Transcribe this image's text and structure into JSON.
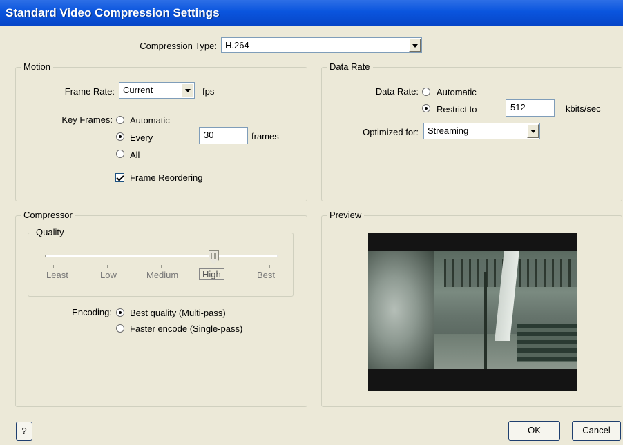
{
  "window": {
    "title": "Standard Video Compression Settings"
  },
  "compression_type": {
    "label": "Compression Type:",
    "value": "H.264"
  },
  "motion": {
    "legend": "Motion",
    "frame_rate_label": "Frame Rate:",
    "frame_rate_value": "Current",
    "fps_unit": "fps",
    "key_frames_label": "Key Frames:",
    "key_frames_options": [
      "Automatic",
      "Every",
      "All"
    ],
    "key_frames_selected": "Every",
    "every_value": "30",
    "frames_unit": "frames",
    "frame_reordering_label": "Frame Reordering",
    "frame_reordering_checked": true
  },
  "data_rate": {
    "legend": "Data Rate",
    "label": "Data Rate:",
    "options": [
      "Automatic",
      "Restrict to"
    ],
    "selected": "Restrict to",
    "restrict_value": "512",
    "unit": "kbits/sec",
    "optimized_label": "Optimized for:",
    "optimized_value": "Streaming"
  },
  "compressor": {
    "legend": "Compressor",
    "quality_legend": "Quality",
    "quality_levels": [
      "Least",
      "Low",
      "Medium",
      "High",
      "Best"
    ],
    "quality_selected": "High",
    "quality_fraction": 0.75,
    "encoding_label": "Encoding:",
    "encoding_options": [
      "Best quality (Multi-pass)",
      "Faster encode (Single-pass)"
    ],
    "encoding_selected": "Best quality (Multi-pass)"
  },
  "preview": {
    "legend": "Preview"
  },
  "buttons": {
    "help": "?",
    "ok": "OK",
    "cancel": "Cancel"
  }
}
